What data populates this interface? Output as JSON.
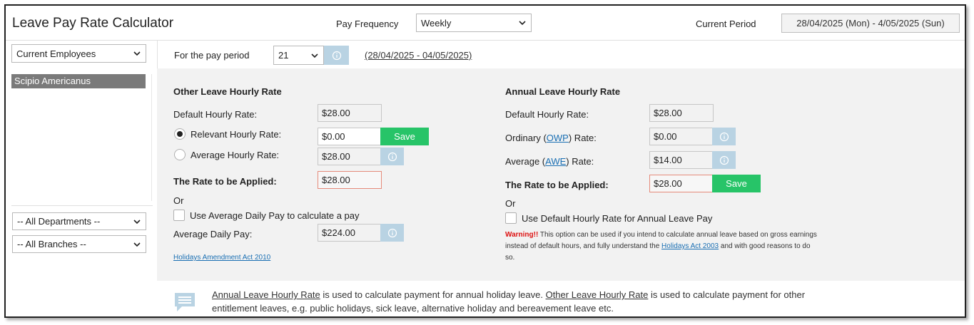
{
  "header": {
    "title": "Leave Pay Rate Calculator",
    "pay_frequency_label": "Pay Frequency",
    "pay_frequency_value": "Weekly",
    "current_period_label": "Current Period",
    "current_period_value": "28/04/2025 (Mon) - 4/05/2025 (Sun)"
  },
  "sidebar": {
    "employee_filter": "Current Employees",
    "employees": [
      "Scipio Americanus"
    ],
    "department_filter": "-- All Departments --",
    "branch_filter": "-- All Branches --"
  },
  "pay_period": {
    "label": "For the pay period",
    "number": "21",
    "range_link": "(28/04/2025 - 04/05/2025)"
  },
  "other_leave": {
    "heading": "Other Leave Hourly Rate",
    "default_label": "Default Hourly Rate:",
    "default_value": "$28.00",
    "relevant_label": "Relevant Hourly Rate:",
    "relevant_value": "$0.00",
    "save_label": "Save",
    "average_label": "Average Hourly Rate:",
    "average_value": "$28.00",
    "applied_label": "The Rate to be Applied:",
    "applied_value": "$28.00",
    "or_label": "Or",
    "avg_daily_checkbox_label": "Use Average Daily Pay to calculate a pay",
    "avg_daily_label": "Average Daily Pay:",
    "avg_daily_value": "$224.00",
    "act_link": "Holidays Amendment Act 2010"
  },
  "annual_leave": {
    "heading": "Annual Leave Hourly Rate",
    "default_label": "Default Hourly Rate:",
    "default_value": "$28.00",
    "ordinary_prefix": "Ordinary (",
    "ordinary_link": "OWP",
    "ordinary_suffix": ") Rate:",
    "ordinary_value": "$0.00",
    "average_prefix": "Average (",
    "average_link": "AWE",
    "average_suffix": ") Rate:",
    "average_value": "$14.00",
    "applied_label": "The Rate to be Applied:",
    "applied_value": "$28.00",
    "save_label": "Save",
    "or_label": "Or",
    "default_checkbox_label": "Use Default Hourly Rate for Annual Leave Pay",
    "warning_strong": "Warning!!",
    "warning_text_1": " This option can be used if you intend to calculate annual leave based on gross earnings instead of default hours, and fully understand the ",
    "warning_link": "Holidays Act 2003",
    "warning_text_2": " and with good reasons to do so."
  },
  "footer": {
    "annual_link": "Annual Leave Hourly Rate",
    "text_1": " is used to calculate payment for annual holiday leave. ",
    "other_link": "Other Leave Hourly Rate",
    "text_2": " is used to calculate payment for other entitlement leaves, e.g. public holidays, sick leave, alternative holiday and bereavement leave etc."
  },
  "colors": {
    "save_green": "#27c468",
    "info_blue": "#b9d3e3",
    "link_blue": "#1a6fb3",
    "warning_red": "#dd1111",
    "selected_gray": "#7a7a7a"
  },
  "icons": {
    "info": "info-circle-icon",
    "chevron": "chevron-down-icon",
    "chat": "chat-bubble-icon"
  }
}
